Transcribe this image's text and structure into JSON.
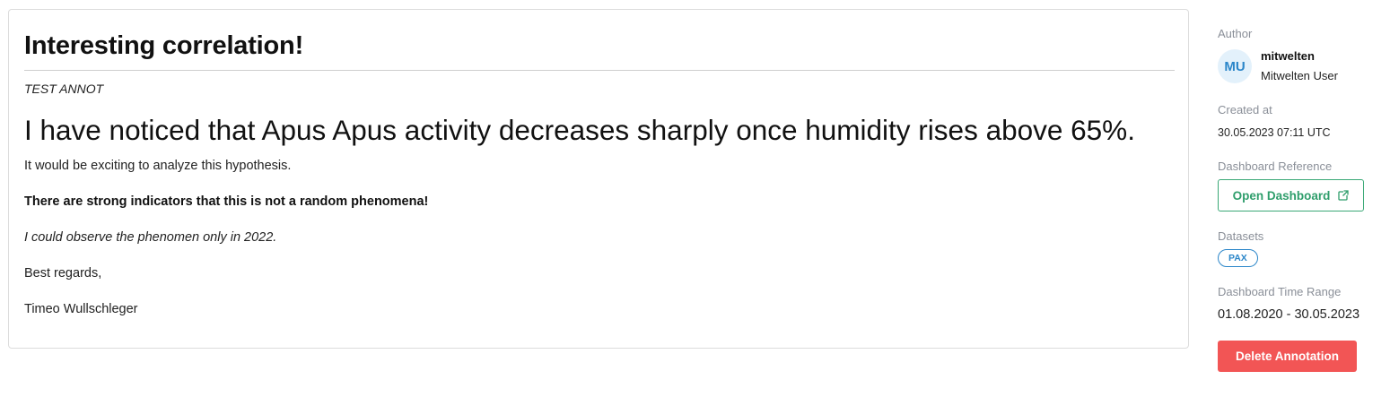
{
  "annotation": {
    "title": "Interesting correlation!",
    "subtitle": "TEST ANNOT",
    "headline": "I have noticed that Apus Apus activity decreases sharply once humidity rises above 65%.",
    "paragraphs": {
      "p1": "It would be exciting to analyze this hypothesis.",
      "p2": "There are strong indicators that this is not a random phenomena!",
      "p3": "I could observe the phenomen only in 2022.",
      "p4": "Best regards,",
      "p5": "Timeo Wullschleger"
    }
  },
  "sidebar": {
    "author_label": "Author",
    "avatar_initials": "MU",
    "author_username": "mitwelten",
    "author_fullname": "Mitwelten User",
    "created_label": "Created at",
    "created_value": "30.05.2023 07:11 UTC",
    "dashboard_ref_label": "Dashboard Reference",
    "open_dashboard_label": "Open Dashboard",
    "open_dashboard_icon": "external-link-icon",
    "datasets_label": "Datasets",
    "datasets": [
      "PAX"
    ],
    "time_range_label": "Dashboard Time Range",
    "time_range_value": "01.08.2020 - 30.05.2023",
    "delete_label": "Delete Annotation"
  },
  "colors": {
    "accent_green": "#3aa876",
    "accent_blue": "#2b86c9",
    "danger_red": "#f25555",
    "avatar_bg": "#e3f1fb",
    "muted_text": "#8a8f98"
  }
}
